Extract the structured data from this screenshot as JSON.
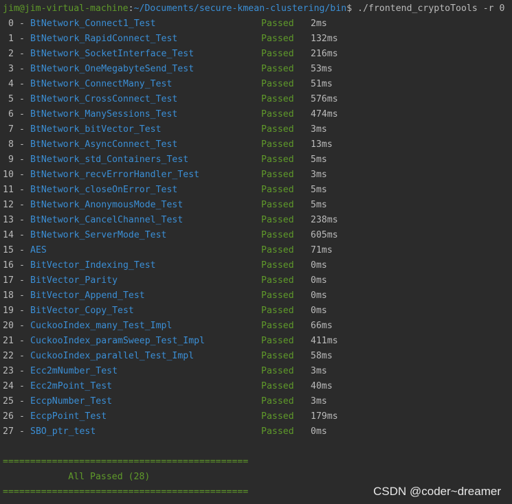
{
  "prompt": {
    "user_host": "jim@jim-virtual-machine",
    "colon": ":",
    "path": "~/Documents/secure-kmean-clustering/bin",
    "dollar": "$",
    "command": " ./frontend_cryptoTools -r 0"
  },
  "tests": [
    {
      "idx": " 0",
      "name": "BtNetwork_Connect1_Test",
      "status": "Passed",
      "time": "2ms"
    },
    {
      "idx": " 1",
      "name": "BtNetwork_RapidConnect_Test",
      "status": "Passed",
      "time": "132ms"
    },
    {
      "idx": " 2",
      "name": "BtNetwork_SocketInterface_Test",
      "status": "Passed",
      "time": "216ms"
    },
    {
      "idx": " 3",
      "name": "BtNetwork_OneMegabyteSend_Test",
      "status": "Passed",
      "time": "53ms"
    },
    {
      "idx": " 4",
      "name": "BtNetwork_ConnectMany_Test",
      "status": "Passed",
      "time": "51ms"
    },
    {
      "idx": " 5",
      "name": "BtNetwork_CrossConnect_Test",
      "status": "Passed",
      "time": "576ms"
    },
    {
      "idx": " 6",
      "name": "BtNetwork_ManySessions_Test",
      "status": "Passed",
      "time": "474ms"
    },
    {
      "idx": " 7",
      "name": "BtNetwork_bitVector_Test",
      "status": "Passed",
      "time": "3ms"
    },
    {
      "idx": " 8",
      "name": "BtNetwork_AsyncConnect_Test",
      "status": "Passed",
      "time": "13ms"
    },
    {
      "idx": " 9",
      "name": "BtNetwork_std_Containers_Test",
      "status": "Passed",
      "time": "5ms"
    },
    {
      "idx": "10",
      "name": "BtNetwork_recvErrorHandler_Test",
      "status": "Passed",
      "time": "3ms"
    },
    {
      "idx": "11",
      "name": "BtNetwork_closeOnError_Test",
      "status": "Passed",
      "time": "5ms"
    },
    {
      "idx": "12",
      "name": "BtNetwork_AnonymousMode_Test",
      "status": "Passed",
      "time": "5ms"
    },
    {
      "idx": "13",
      "name": "BtNetwork_CancelChannel_Test",
      "status": "Passed",
      "time": "238ms"
    },
    {
      "idx": "14",
      "name": "BtNetwork_ServerMode_Test",
      "status": "Passed",
      "time": "605ms"
    },
    {
      "idx": "15",
      "name": "AES",
      "status": "Passed",
      "time": "71ms"
    },
    {
      "idx": "16",
      "name": "BitVector_Indexing_Test",
      "status": "Passed",
      "time": "0ms"
    },
    {
      "idx": "17",
      "name": "BitVector_Parity",
      "status": "Passed",
      "time": "0ms"
    },
    {
      "idx": "18",
      "name": "BitVector_Append_Test",
      "status": "Passed",
      "time": "0ms"
    },
    {
      "idx": "19",
      "name": "BitVector_Copy_Test",
      "status": "Passed",
      "time": "0ms"
    },
    {
      "idx": "20",
      "name": "CuckooIndex_many_Test_Impl",
      "status": "Passed",
      "time": "66ms"
    },
    {
      "idx": "21",
      "name": "CuckooIndex_paramSweep_Test_Impl",
      "status": "Passed",
      "time": "411ms"
    },
    {
      "idx": "22",
      "name": "CuckooIndex_parallel_Test_Impl",
      "status": "Passed",
      "time": "58ms"
    },
    {
      "idx": "23",
      "name": "Ecc2mNumber_Test",
      "status": "Passed",
      "time": "3ms"
    },
    {
      "idx": "24",
      "name": "Ecc2mPoint_Test",
      "status": "Passed",
      "time": "40ms"
    },
    {
      "idx": "25",
      "name": "EccpNumber_Test",
      "status": "Passed",
      "time": "3ms"
    },
    {
      "idx": "26",
      "name": "EccpPoint_Test",
      "status": "Passed",
      "time": "179ms"
    },
    {
      "idx": "27",
      "name": "SBO_ptr_test",
      "status": "Passed",
      "time": "0ms"
    }
  ],
  "summary": {
    "separator": "=============================================",
    "text": "            All Passed (28)"
  },
  "watermark": "CSDN @coder~dreamer",
  "colors": {
    "background": "#2b2b2b",
    "pass": "#5f9a2a",
    "name": "#3b8fd6",
    "text": "#bbbbbb"
  }
}
